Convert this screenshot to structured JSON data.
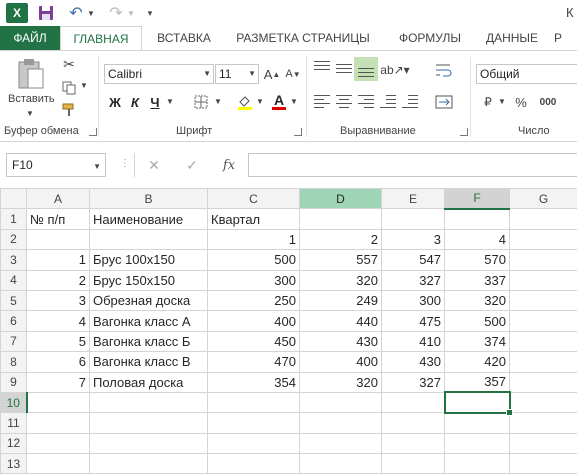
{
  "quick_access": {
    "logo_letter": "X",
    "title_partial": "К"
  },
  "tabs": [
    {
      "label": "ФАЙЛ"
    },
    {
      "label": "ГЛАВНАЯ"
    },
    {
      "label": "ВСТАВКА"
    },
    {
      "label": "РАЗМЕТКА СТРАНИЦЫ"
    },
    {
      "label": "ФОРМУЛЫ"
    },
    {
      "label": "ДАННЫЕ"
    },
    {
      "label": "Р"
    }
  ],
  "ribbon": {
    "clipboard": {
      "label": "Буфер обмена",
      "paste_label": "Вставить"
    },
    "font": {
      "label": "Шрифт",
      "font_name": "Calibri",
      "font_size": "11",
      "bold": "Ж",
      "italic": "К",
      "underline": "Ч",
      "grow": "A",
      "shrink": "A",
      "font_color_letter": "A"
    },
    "alignment": {
      "label": "Выравнивание"
    },
    "number": {
      "label": "Число",
      "format": "Общий",
      "currency": "₽",
      "percent": "%",
      "comma": "000"
    }
  },
  "formula_bar": {
    "name_box": "F10",
    "fx": "fx",
    "cancel": "✕",
    "enter": "✓",
    "value": ""
  },
  "grid": {
    "columns": [
      "A",
      "B",
      "C",
      "D",
      "E",
      "F",
      "G"
    ],
    "selected_column": "F",
    "highlight_column": "D",
    "selected_row": "10",
    "active_cell": "F10",
    "rows": [
      {
        "n": "1",
        "cells": [
          "№ п/п",
          "Наименование",
          "Квартал",
          "",
          "",
          "",
          ""
        ]
      },
      {
        "n": "2",
        "cells": [
          "",
          "",
          "1",
          "2",
          "3",
          "4",
          ""
        ]
      },
      {
        "n": "3",
        "cells": [
          "1",
          "Брус 100х150",
          "500",
          "557",
          "547",
          "570",
          ""
        ]
      },
      {
        "n": "4",
        "cells": [
          "2",
          "Брус 150х150",
          "300",
          "320",
          "327",
          "337",
          ""
        ]
      },
      {
        "n": "5",
        "cells": [
          "3",
          "Обрезная доска",
          "250",
          "249",
          "300",
          "320",
          ""
        ]
      },
      {
        "n": "6",
        "cells": [
          "4",
          "Вагонка класс А",
          "400",
          "440",
          "475",
          "500",
          ""
        ]
      },
      {
        "n": "7",
        "cells": [
          "5",
          "Вагонка класс Б",
          "450",
          "430",
          "410",
          "374",
          ""
        ]
      },
      {
        "n": "8",
        "cells": [
          "6",
          "Вагонка класс В",
          "470",
          "400",
          "430",
          "420",
          ""
        ]
      },
      {
        "n": "9",
        "cells": [
          "7",
          "Половая доска",
          "354",
          "320",
          "327",
          "357",
          ""
        ]
      },
      {
        "n": "10",
        "cells": [
          "",
          "",
          "",
          "",
          "",
          "",
          ""
        ]
      },
      {
        "n": "11",
        "cells": [
          "",
          "",
          "",
          "",
          "",
          "",
          ""
        ]
      },
      {
        "n": "12",
        "cells": [
          "",
          "",
          "",
          "",
          "",
          "",
          ""
        ]
      },
      {
        "n": "13",
        "cells": [
          "",
          "",
          "",
          "",
          "",
          "",
          ""
        ]
      }
    ]
  },
  "colors": {
    "accent": "#217346",
    "highlight_col": "#9fd5b7"
  }
}
